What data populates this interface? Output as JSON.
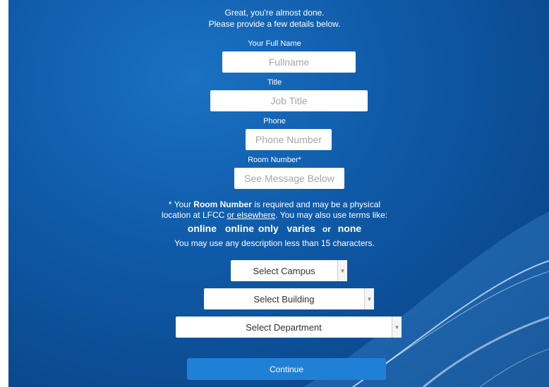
{
  "intro": {
    "line1": "Great, you're almost done.",
    "line2": "Please provide a few details below."
  },
  "fields": {
    "fullname": {
      "label": "Your Full Name",
      "placeholder": "Fullname"
    },
    "title": {
      "label": "Title",
      "placeholder": "Job Title"
    },
    "phone": {
      "label": "Phone",
      "placeholder": "Phone Number"
    },
    "room": {
      "label": "Room Number*",
      "placeholder": "See Message Below"
    }
  },
  "note": {
    "part1": "* Your ",
    "bold": "Room Number",
    "part2": " is required and may be a physical",
    "part3": "location at LFCC ",
    "link": "or elsewhere",
    "part4": ". You may also use terms like:",
    "terms": [
      "online",
      "online only",
      "varies",
      "none"
    ],
    "or_word": "or",
    "limit": "You may use any description less than 15 characters."
  },
  "selects": {
    "campus": "Select Campus",
    "building": "Select Building",
    "department": "Select Department"
  },
  "continue_label": "Continue",
  "colors": {
    "accent": "#1f80d6",
    "background": "#0f5aa8"
  }
}
